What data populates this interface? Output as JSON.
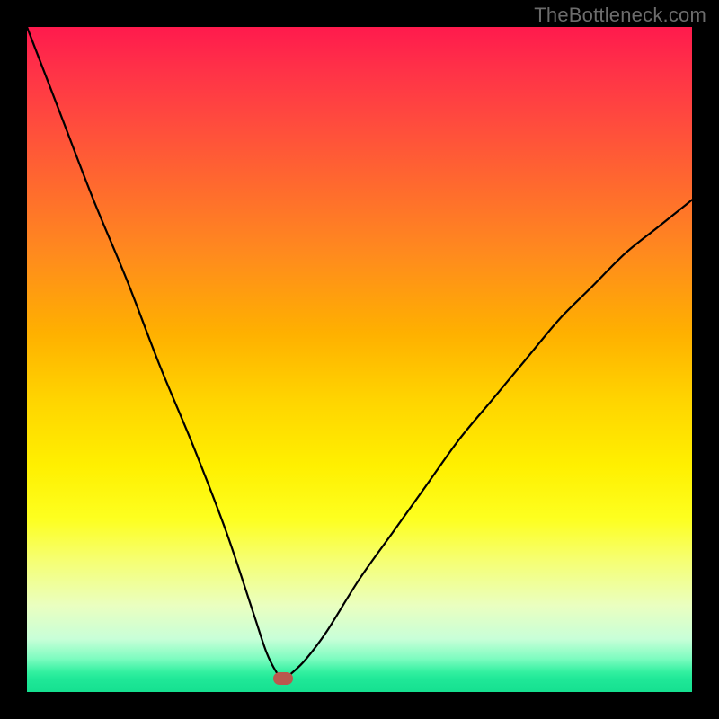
{
  "watermark": "TheBottleneck.com",
  "colors": {
    "marker_fill": "#b9594e",
    "curve_stroke": "#000000",
    "frame": "#000000"
  },
  "chart_data": {
    "type": "line",
    "title": "",
    "xlabel": "",
    "ylabel": "",
    "xlim": [
      0,
      100
    ],
    "ylim": [
      0,
      100
    ],
    "grid": false,
    "legend": null,
    "annotations": [
      {
        "type": "marker",
        "x": 38.5,
        "y": 2.0,
        "shape": "rounded-rect",
        "color": "#b9594e"
      }
    ],
    "series": [
      {
        "name": "bottleneck-curve",
        "x": [
          0,
          5,
          10,
          15,
          20,
          25,
          30,
          34,
          36,
          37.5,
          38.5,
          40,
          42,
          45,
          50,
          55,
          60,
          65,
          70,
          75,
          80,
          85,
          90,
          95,
          100
        ],
        "y": [
          100,
          87,
          74,
          62,
          49,
          37,
          24,
          12,
          6,
          3,
          2,
          3,
          5,
          9,
          17,
          24,
          31,
          38,
          44,
          50,
          56,
          61,
          66,
          70,
          74
        ]
      }
    ]
  }
}
